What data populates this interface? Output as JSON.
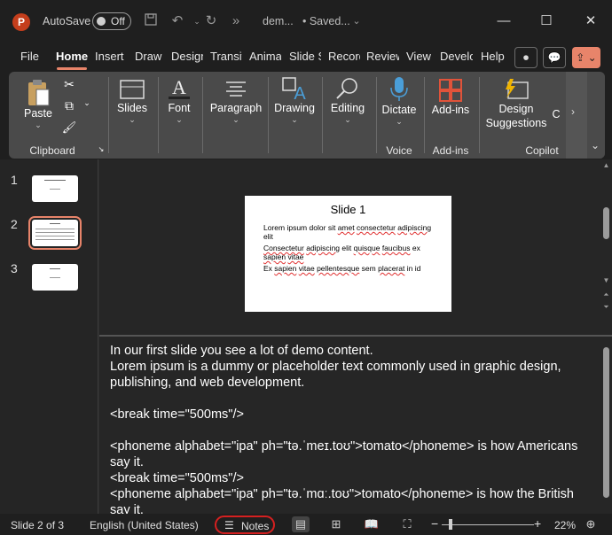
{
  "titlebar": {
    "app_logo": "P",
    "autosave_label": "AutoSave",
    "autosave_state": "Off",
    "doc_name": "dem...",
    "doc_status": "• Saved...",
    "icons": [
      "save-icon",
      "undo-icon",
      "redo-icon",
      "more-icon",
      "chevron-down-icon",
      "minimize-icon",
      "maximize-icon",
      "close-icon"
    ]
  },
  "tabs": [
    {
      "label": "File"
    },
    {
      "label": "Home"
    },
    {
      "label": "Insert"
    },
    {
      "label": "Draw"
    },
    {
      "label": "Design"
    },
    {
      "label": "Transitions"
    },
    {
      "label": "Animations"
    },
    {
      "label": "Slide Show"
    },
    {
      "label": "Record"
    },
    {
      "label": "Review"
    },
    {
      "label": "View"
    },
    {
      "label": "Developer"
    },
    {
      "label": "Help"
    }
  ],
  "ribbon": {
    "paste": "Paste",
    "slides": "Slides",
    "font": "Font",
    "paragraph": "Paragraph",
    "drawing": "Drawing",
    "editing": "Editing",
    "dictate": "Dictate",
    "addins": "Add-ins",
    "design_suggestions_1": "Design",
    "design_suggestions_2": "Suggestions",
    "copilot_partial": "C",
    "groups": {
      "clipboard": "Clipboard",
      "voice": "Voice",
      "addins": "Add-ins",
      "copilot": "Copilot"
    }
  },
  "thumbnails": [
    {
      "num": "1"
    },
    {
      "num": "2"
    },
    {
      "num": "3"
    }
  ],
  "slide": {
    "title": "Slide 1",
    "lines": [
      "Lorem ipsum dolor sit amet consectetur adipiscing elit",
      "Consectetur adipiscing elit quisque faucibus ex sapien vitae",
      "Ex sapien vitae pellentesque sem placerat in id"
    ]
  },
  "notes": {
    "lines": [
      "In our first slide you see a lot of demo content.",
      "Lorem ipsum is a dummy or placeholder text commonly used in graphic design, publishing, and web development.",
      "",
      "<break time=\"500ms\"/>",
      "",
      "<phoneme alphabet=\"ipa\" ph=\"tə.ˈmeɪ.toʊ\">tomato</phoneme> is how Americans say it.",
      "<break time=\"500ms\"/>",
      "<phoneme alphabet=\"ipa\" ph=\"tə.ˈmɑː.toʊ\">tomato</phoneme> is how the British say it."
    ]
  },
  "statusbar": {
    "slide_counter": "Slide 2 of 3",
    "language": "English (United States)",
    "notes_label": "Notes",
    "zoom_minus": "−",
    "zoom_plus": "+",
    "zoom_level": "22%"
  },
  "colors": {
    "accent": "#e8846a",
    "highlight_circle": "#d62020"
  }
}
